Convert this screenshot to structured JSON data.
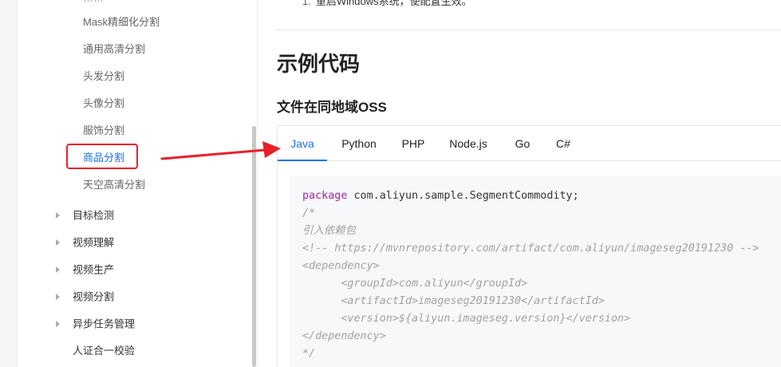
{
  "sidebar": {
    "top_cut_item": "……",
    "sub_items": [
      {
        "label": "Mask精细化分割"
      },
      {
        "label": "通用高清分割"
      },
      {
        "label": "头发分割"
      },
      {
        "label": "头像分割"
      },
      {
        "label": "服饰分割"
      },
      {
        "label": "商品分割"
      },
      {
        "label": "天空高清分割"
      }
    ],
    "groups": [
      {
        "label": "目标检测"
      },
      {
        "label": "视频理解"
      },
      {
        "label": "视频生产"
      },
      {
        "label": "视频分割"
      },
      {
        "label": "异步任务管理"
      }
    ],
    "plain_item": "人证合一校验",
    "active_item": "商品分割"
  },
  "main": {
    "restart_step_number": "1.",
    "restart_text": "重启Windows系统，使配置生效。",
    "section_title": "示例代码",
    "subsection_title": "文件在同地域OSS",
    "tabs": [
      {
        "label": "Java"
      },
      {
        "label": "Python"
      },
      {
        "label": "PHP"
      },
      {
        "label": "Node.js"
      },
      {
        "label": "Go"
      },
      {
        "label": "C#"
      }
    ],
    "active_tab": "Java",
    "code": {
      "kw_package": "package",
      "package_name": " com.aliyun.sample.SegmentCommodity;",
      "comment_open": "/*",
      "comment_intro": "引入依赖包",
      "comment_url": "<!-- https://mvnrepository.com/artifact/com.aliyun/imageseg20191230 -->",
      "dep_open": "<dependency>",
      "group_id": "      <groupId>com.aliyun</groupId>",
      "artifact_id": "      <artifactId>imageseg20191230</artifactId>",
      "version": "      <version>${aliyun.imageseg.version}</version>",
      "dep_close": "</dependency>",
      "comment_close": "*/"
    }
  },
  "colors": {
    "accent": "#1a73e8",
    "annotation_red": "#e8202a",
    "keyword": "#a626a4",
    "comment": "#a0a1a7"
  }
}
